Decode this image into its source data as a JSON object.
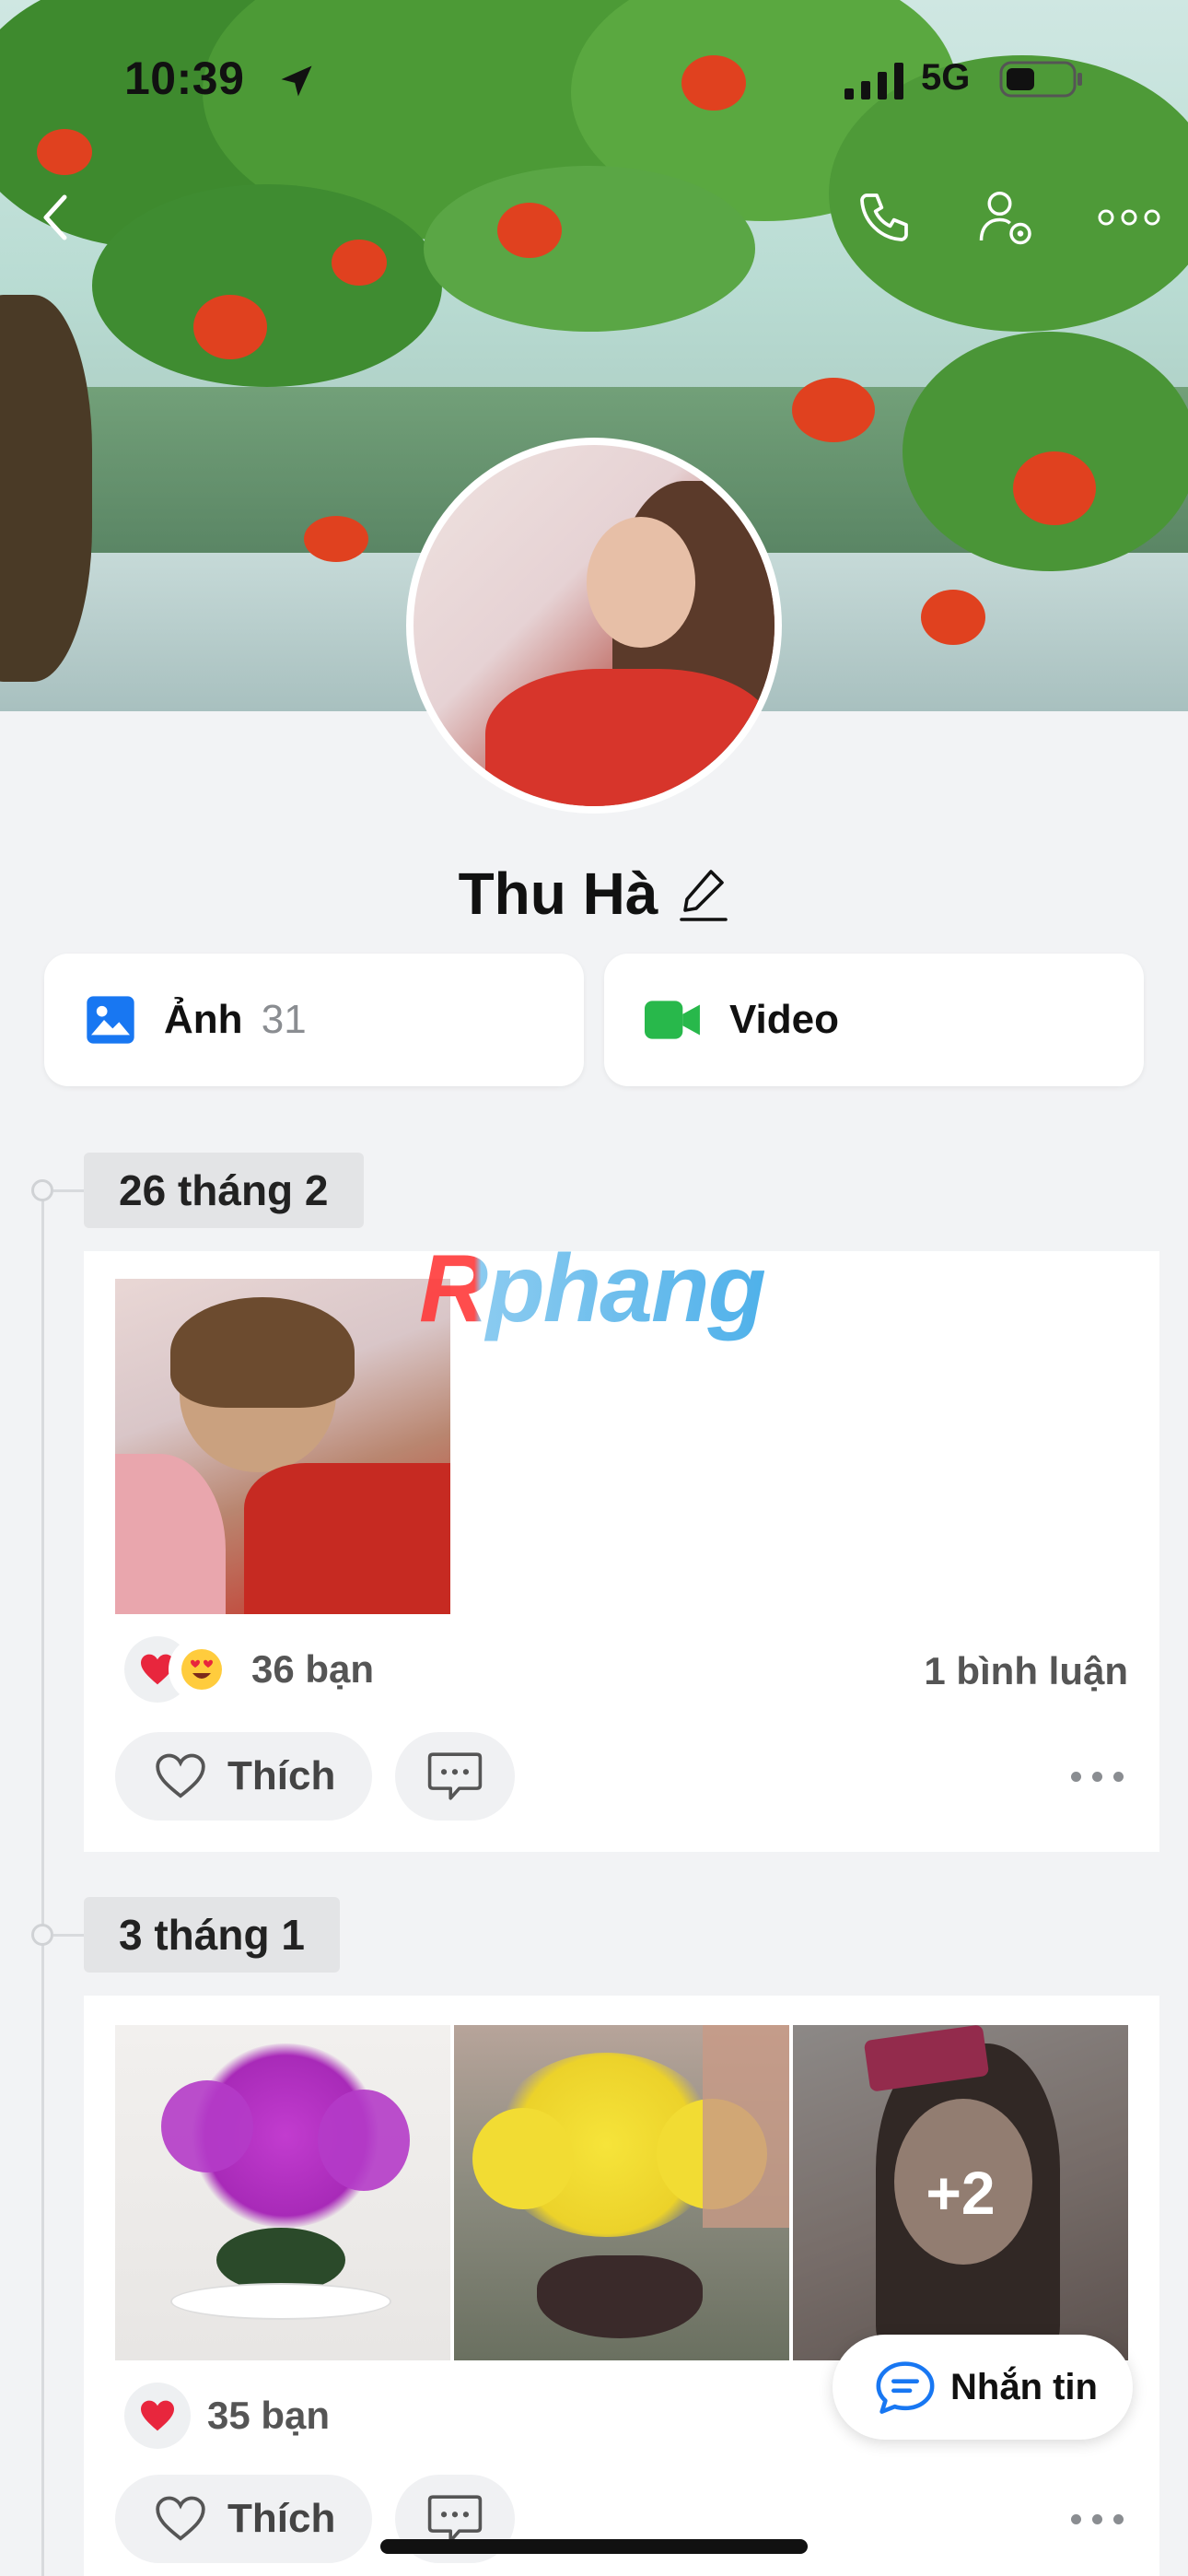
{
  "status_bar": {
    "time": "10:39",
    "network": "5G"
  },
  "top_bar": {
    "icons": [
      "back-icon",
      "phone-icon",
      "profile-settings-icon",
      "more-icon"
    ]
  },
  "profile": {
    "name": "Thu Hà"
  },
  "media_tabs": {
    "photos_label": "Ảnh",
    "photos_count": "31",
    "video_label": "Video"
  },
  "watermark": "Rphang",
  "posts": [
    {
      "date": "26 tháng 2",
      "reactions_count": "36 bạn",
      "comments": "1 bình luận",
      "like_label": "Thích"
    },
    {
      "date": "3 tháng 1",
      "reactions_count": "35 bạn",
      "extra_photos": "+2",
      "like_label": "Thích"
    }
  ],
  "chat_button": {
    "label": "Nhắn tin"
  },
  "colors": {
    "accent_blue": "#1877f2",
    "video_green": "#28b84b",
    "heart_red": "#e8263d"
  }
}
